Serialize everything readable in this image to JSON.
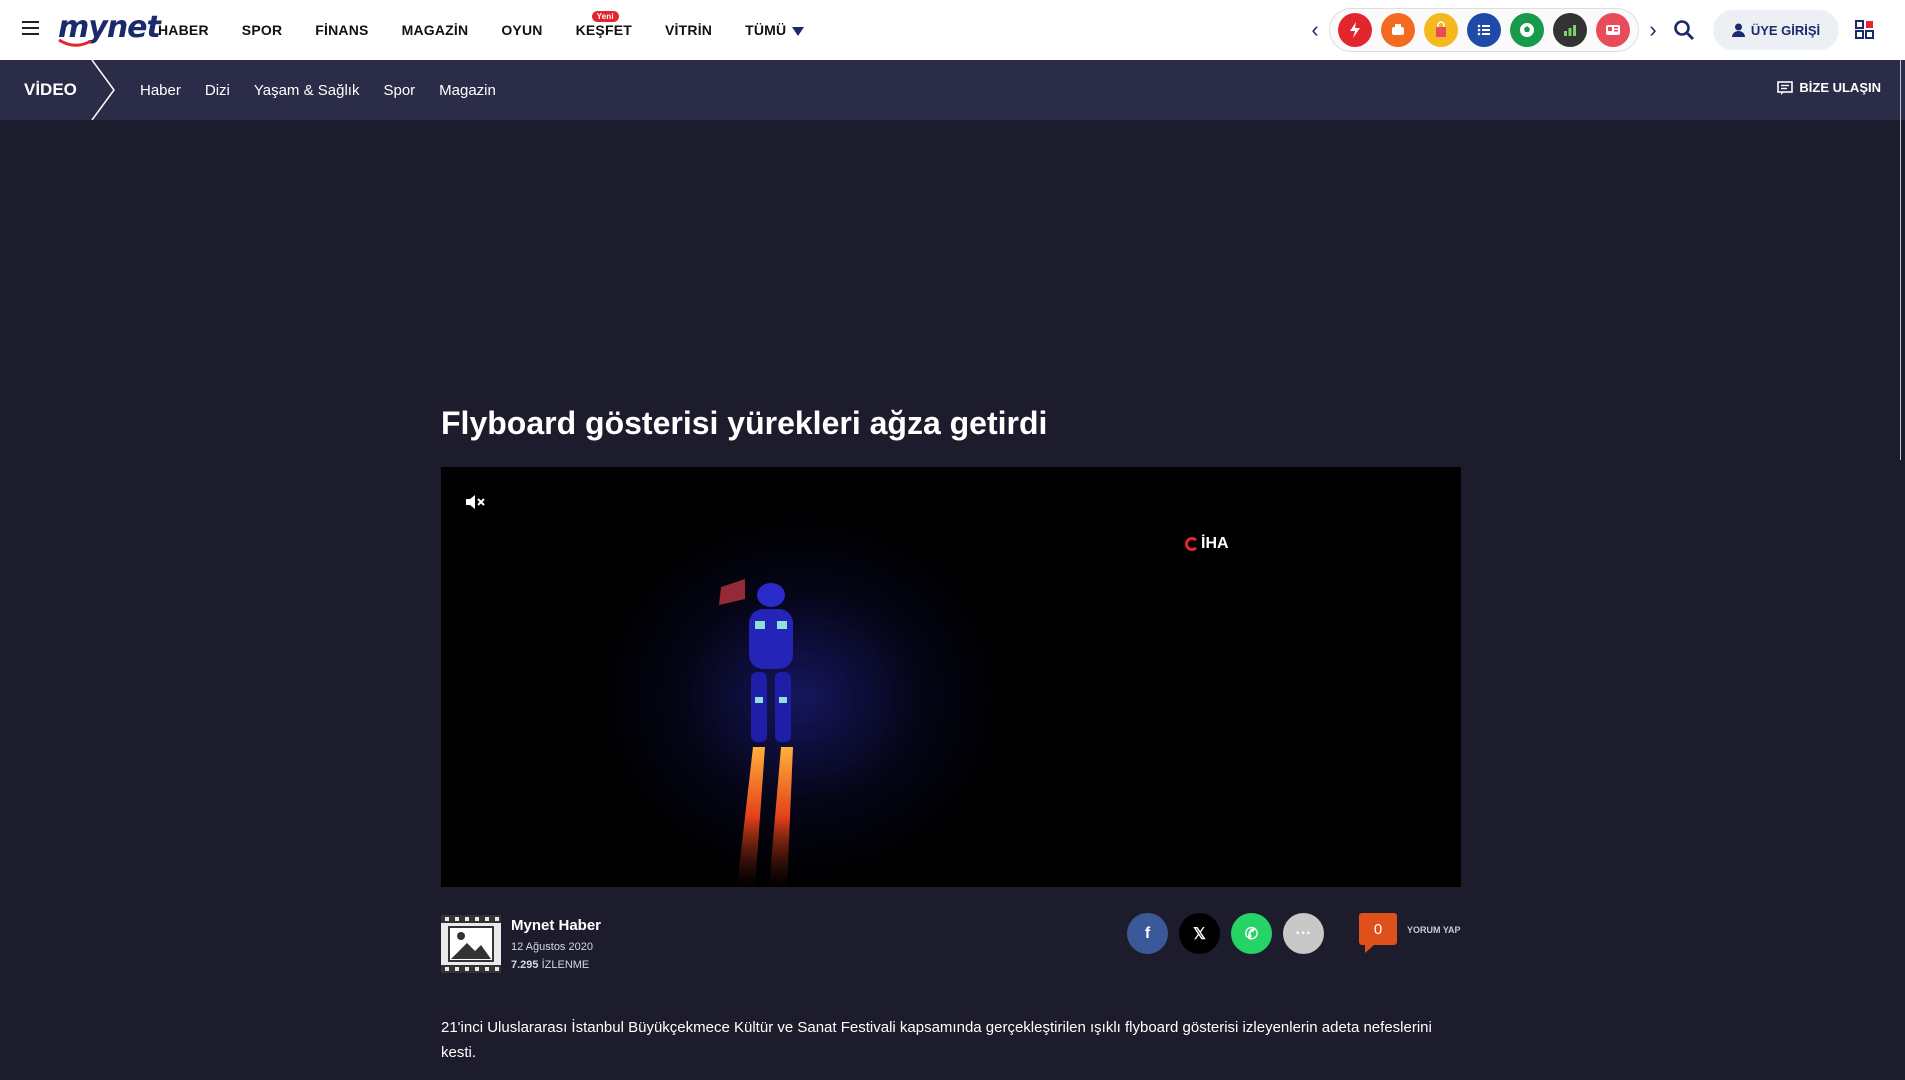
{
  "header": {
    "logo": "mynet",
    "nav": [
      {
        "label": "HABER"
      },
      {
        "label": "SPOR"
      },
      {
        "label": "FİNANS"
      },
      {
        "label": "MAGAZİN"
      },
      {
        "label": "OYUN"
      },
      {
        "label": "KEŞFET",
        "badge": "Yeni"
      },
      {
        "label": "VİTRİN"
      },
      {
        "label": "TÜMÜ"
      }
    ],
    "quick_icons": [
      {
        "name": "flash-icon",
        "color": "#e3262e"
      },
      {
        "name": "food-icon",
        "color": "#f26b21"
      },
      {
        "name": "shopping-icon",
        "color": "#f5b81f"
      },
      {
        "name": "list-icon",
        "color": "#1f4aa8"
      },
      {
        "name": "football-icon",
        "color": "#179b4a"
      },
      {
        "name": "finance-chart-icon",
        "color": "#333333"
      },
      {
        "name": "news-icon",
        "color": "#e84c5b"
      }
    ],
    "login_label": "ÜYE GİRİŞİ"
  },
  "subnav": {
    "section": "VİDEO",
    "items": [
      "Haber",
      "Dizi",
      "Yaşam & Sağlık",
      "Spor",
      "Magazin"
    ],
    "contact_label": "BİZE ULAŞIN"
  },
  "article": {
    "title": "Flyboard gösterisi yürekleri ağza getirdi",
    "video": {
      "watermark": "İHA",
      "muted": true
    },
    "author": "Mynet Haber",
    "date": "12 Ağustos 2020",
    "views_count": "7.295",
    "views_label": "İZLENME",
    "share": [
      {
        "name": "facebook",
        "glyph": "f",
        "color": "#3b5998"
      },
      {
        "name": "x",
        "glyph": "𝕏",
        "color": "#000000"
      },
      {
        "name": "whatsapp",
        "glyph": "✆",
        "color": "#25d366"
      },
      {
        "name": "more",
        "glyph": "···",
        "color": "#c8c8c8"
      }
    ],
    "comment_count": "0",
    "comment_label": "YORUM YAP",
    "description": "21'inci Uluslararası İstanbul Büyükçekmece Kültür ve Sanat Festivali kapsamında gerçekleştirilen ışıklı flyboard gösterisi izleyenlerin adeta nefeslerini kesti."
  }
}
